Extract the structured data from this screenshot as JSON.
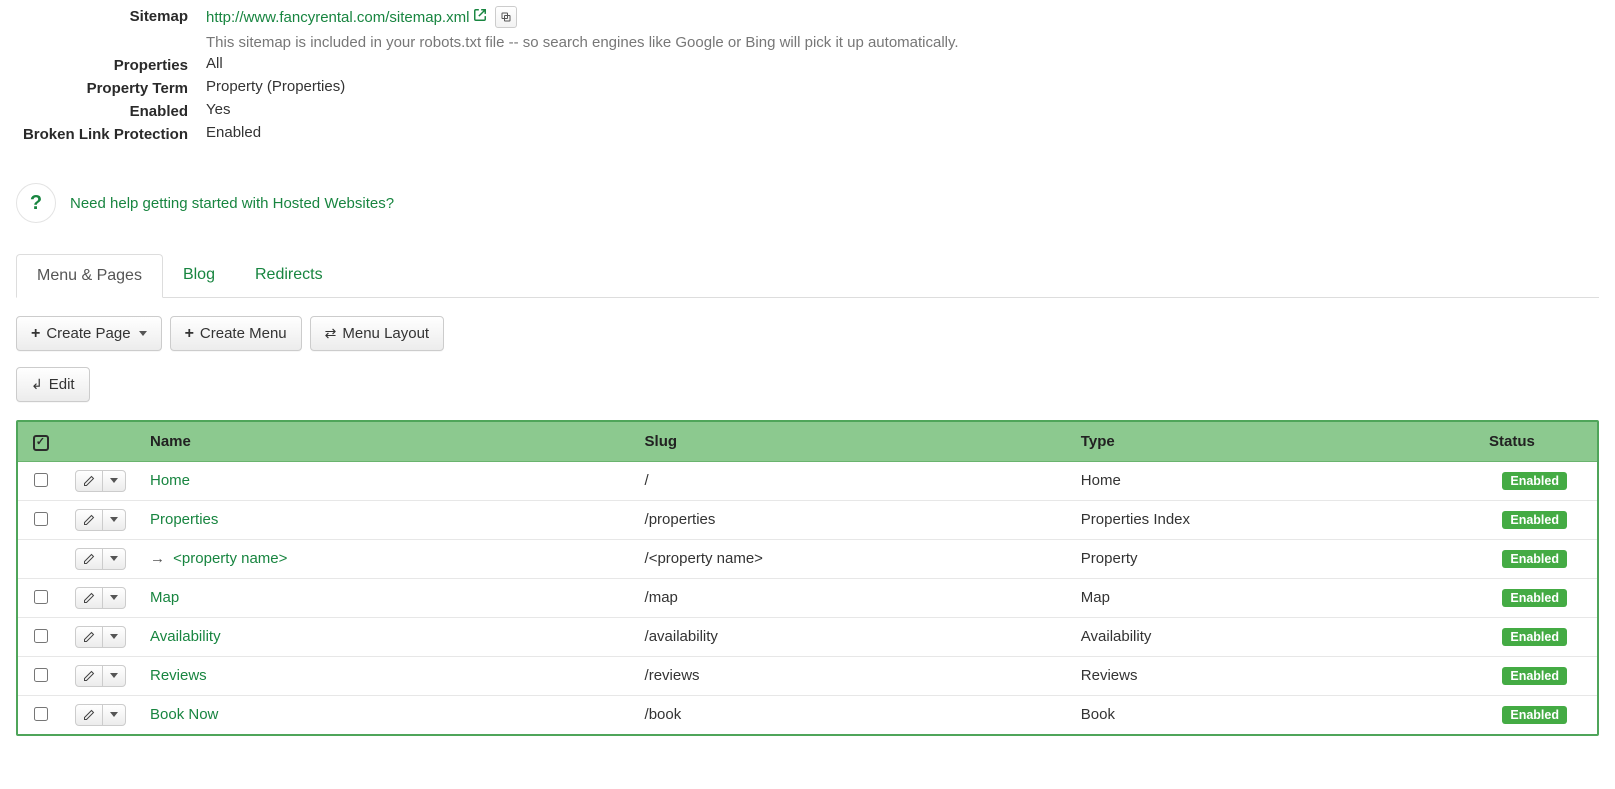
{
  "details": {
    "sitemap_label": "Sitemap",
    "sitemap_url": "http://www.fancyrental.com/sitemap.xml",
    "sitemap_note": "This sitemap is included in your robots.txt file -- so search engines like Google or Bing will pick it up automatically.",
    "properties_label": "Properties",
    "properties_value": "All",
    "property_term_label": "Property Term",
    "property_term_value": "Property (Properties)",
    "enabled_label": "Enabled",
    "enabled_value": "Yes",
    "blp_label": "Broken Link Protection",
    "blp_value": "Enabled"
  },
  "help": {
    "text": "Need help getting started with Hosted Websites?"
  },
  "tabs": {
    "menu_pages": "Menu & Pages",
    "blog": "Blog",
    "redirects": "Redirects"
  },
  "toolbar": {
    "create_page": "Create Page",
    "create_menu": "Create Menu",
    "menu_layout": "Menu Layout",
    "edit": "Edit"
  },
  "table": {
    "headers": {
      "name": "Name",
      "slug": "Slug",
      "type": "Type",
      "status": "Status"
    },
    "rows": [
      {
        "name": "Home",
        "slug": "/",
        "type": "Home",
        "status": "Enabled",
        "indent": false,
        "has_check": true,
        "template": false
      },
      {
        "name": "Properties",
        "slug": "/properties",
        "type": "Properties Index",
        "status": "Enabled",
        "indent": false,
        "has_check": true,
        "template": false
      },
      {
        "name": "<property name>",
        "slug": "/<property name>",
        "type": "Property",
        "status": "Enabled",
        "indent": true,
        "has_check": false,
        "template": true
      },
      {
        "name": "Map",
        "slug": "/map",
        "type": "Map",
        "status": "Enabled",
        "indent": false,
        "has_check": true,
        "template": false
      },
      {
        "name": "Availability",
        "slug": "/availability",
        "type": "Availability",
        "status": "Enabled",
        "indent": false,
        "has_check": true,
        "template": false
      },
      {
        "name": "Reviews",
        "slug": "/reviews",
        "type": "Reviews",
        "status": "Enabled",
        "indent": false,
        "has_check": true,
        "template": false
      },
      {
        "name": "Book Now",
        "slug": "/book",
        "type": "Book",
        "status": "Enabled",
        "indent": false,
        "has_check": true,
        "template": false
      }
    ]
  }
}
